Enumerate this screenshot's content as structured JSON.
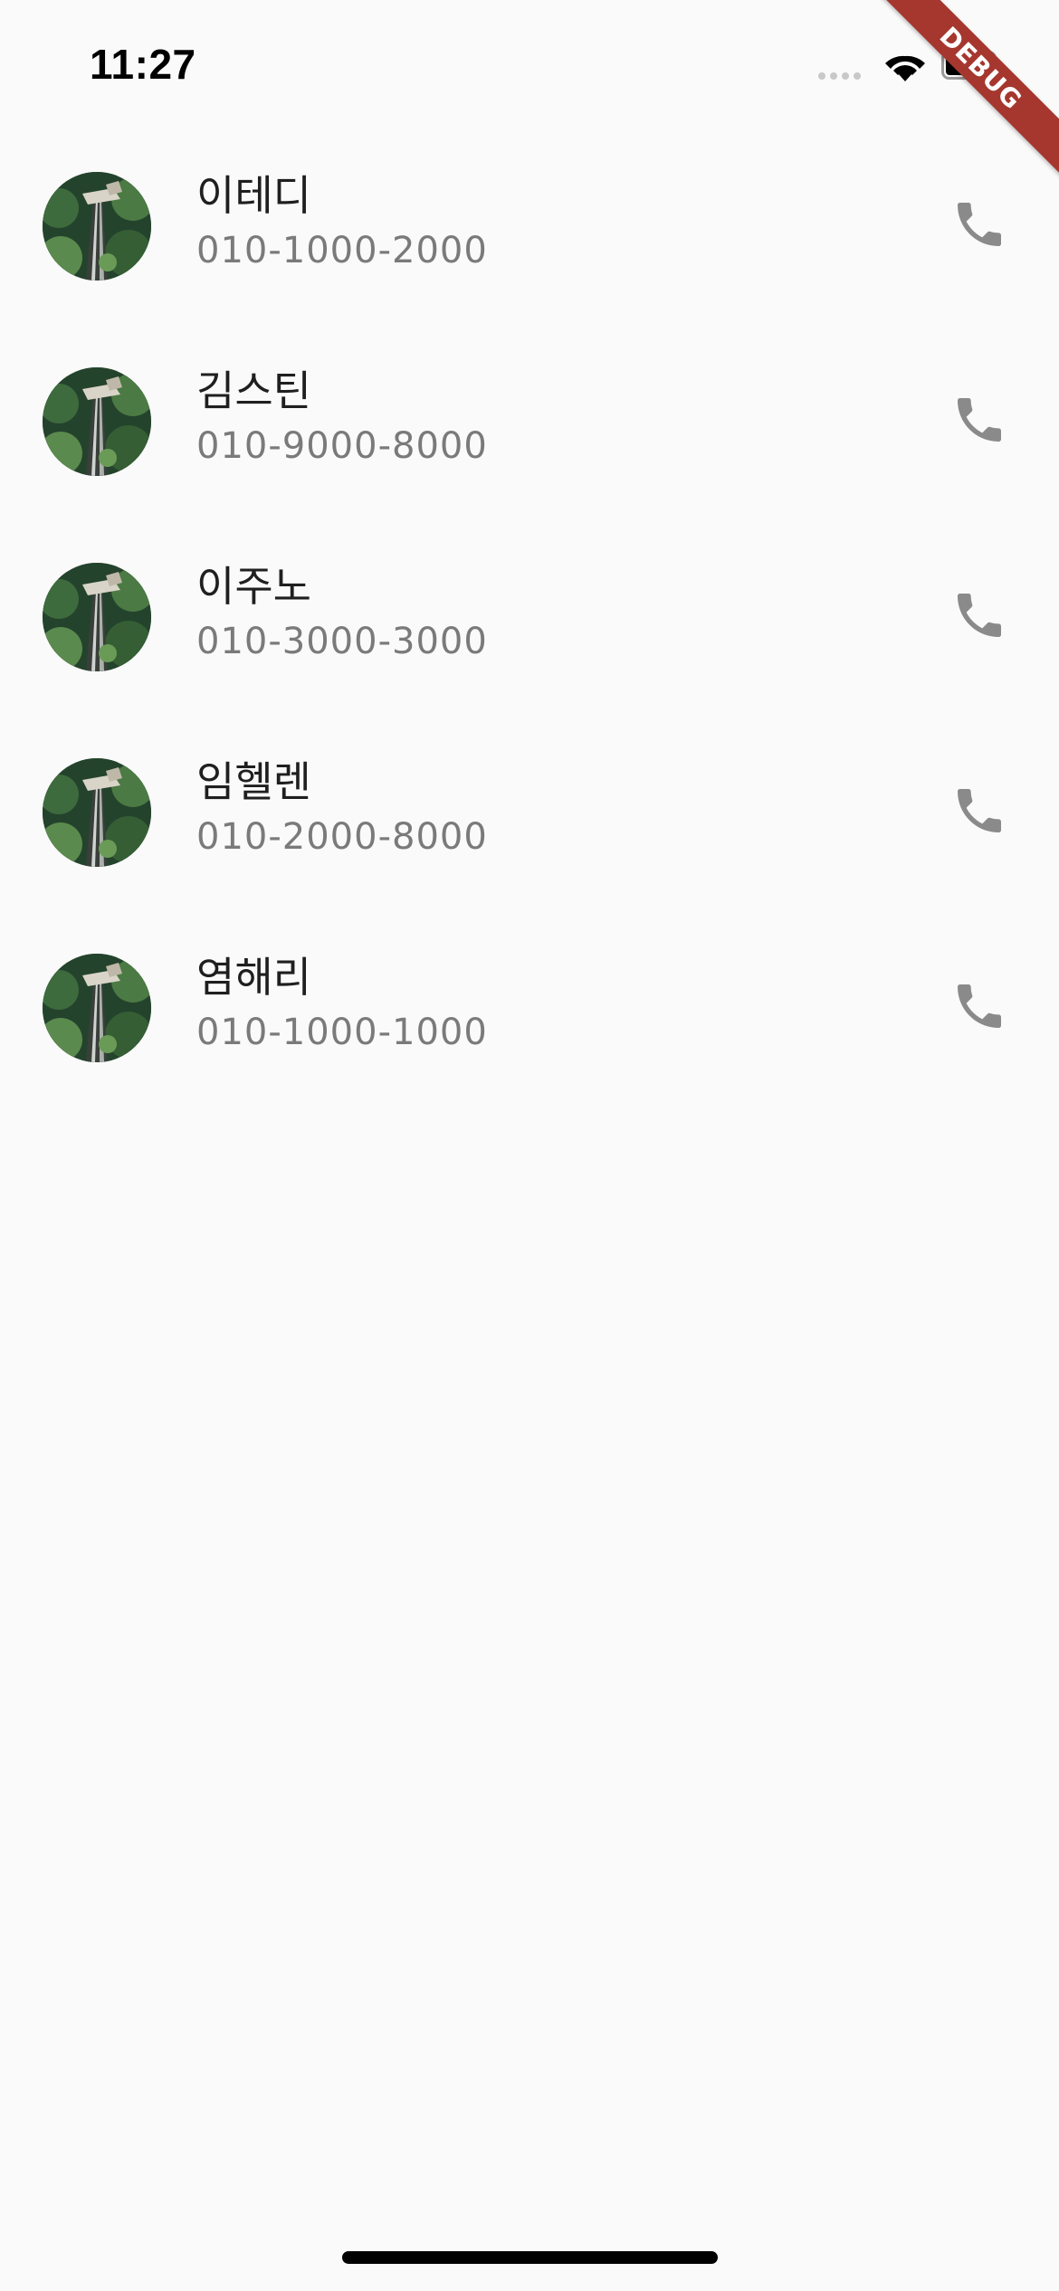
{
  "status_bar": {
    "time": "11:27"
  },
  "debug_banner": {
    "label": "DEBUG",
    "color": "#a5372f"
  },
  "contacts": [
    {
      "name": "이테디",
      "phone": "010-1000-2000"
    },
    {
      "name": "김스틴",
      "phone": "010-9000-8000"
    },
    {
      "name": "이주노",
      "phone": "010-3000-3000"
    },
    {
      "name": "임헬렌",
      "phone": "010-2000-8000"
    },
    {
      "name": "염해리",
      "phone": "010-1000-1000"
    }
  ],
  "icons": {
    "call": "phone-icon",
    "avatar": "avatar-photo"
  },
  "colors": {
    "background": "#fafafa",
    "name_text": "#1f1f1f",
    "phone_text": "#7a7a7a",
    "call_icon": "#8a8a8a"
  }
}
